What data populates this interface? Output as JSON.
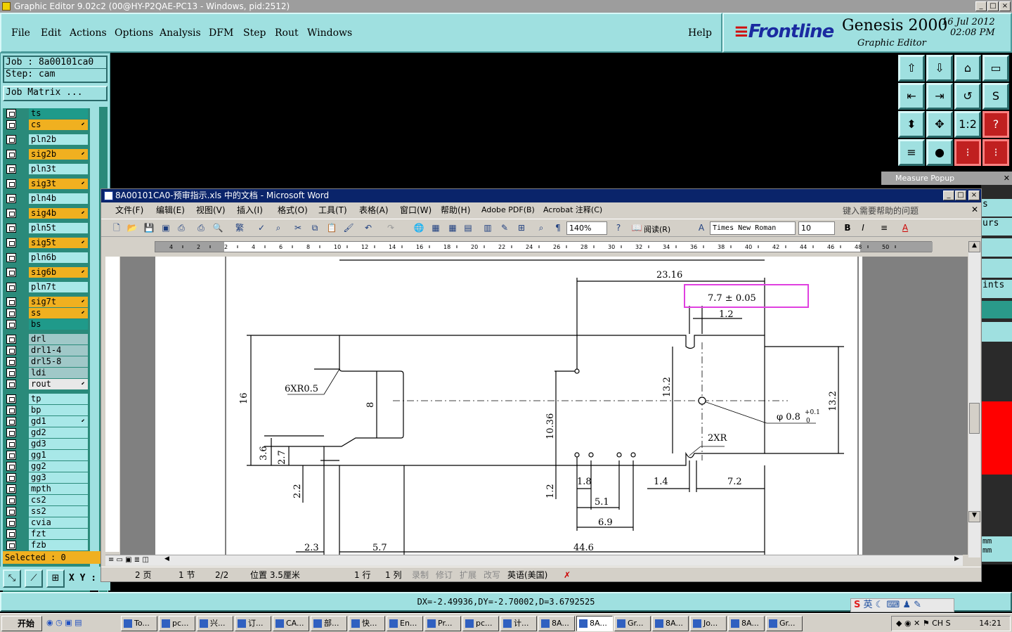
{
  "genesis": {
    "title": "Graphic Editor 9.02c2 (00@HY-P2QAE-PC13 - Windows, pid:2512)",
    "menu": [
      "File",
      "Edit",
      "Actions",
      "Options",
      "Analysis",
      "DFM",
      "Step",
      "Rout",
      "Windows"
    ],
    "help": "Help",
    "logo_brand": "Frontline",
    "logo_product": "Genesis 2000",
    "logo_sub": "Graphic Editor",
    "date": "16 Jul 2012",
    "time": "02:08 PM",
    "job": "Job : 8a00101ca0",
    "step": "Step: cam",
    "job_matrix": "Job Matrix ...",
    "layers": [
      {
        "name": "ts",
        "color": "#1f9a8a"
      },
      {
        "name": "cs",
        "color": "#f0b020",
        "arrow": true
      },
      {
        "name": "pln2b",
        "color": "#a8e8e8"
      },
      {
        "name": "sig2b",
        "color": "#f0b020",
        "arrow": true
      },
      {
        "name": "pln3t",
        "color": "#a8e8e8"
      },
      {
        "name": "sig3t",
        "color": "#f0b020",
        "arrow": true
      },
      {
        "name": "pln4b",
        "color": "#a8e8e8"
      },
      {
        "name": "sig4b",
        "color": "#f0b020",
        "arrow": true
      },
      {
        "name": "pln5t",
        "color": "#a8e8e8"
      },
      {
        "name": "sig5t",
        "color": "#f0b020",
        "arrow": true
      },
      {
        "name": "pln6b",
        "color": "#a8e8e8"
      },
      {
        "name": "sig6b",
        "color": "#f0b020",
        "arrow": true
      },
      {
        "name": "pln7t",
        "color": "#a8e8e8"
      },
      {
        "name": "sig7t",
        "color": "#f0b020",
        "arrow": true
      },
      {
        "name": "ss",
        "color": "#f0b020",
        "arrow": true
      },
      {
        "name": "bs",
        "color": "#1f9a8a"
      },
      {
        "name": "drl",
        "color": "#a0c8c8"
      },
      {
        "name": "drl1-4",
        "color": "#a0c8c8"
      },
      {
        "name": "drl5-8",
        "color": "#a0c8c8"
      },
      {
        "name": "ldi",
        "color": "#a0c8c8"
      },
      {
        "name": "rout",
        "color": "#e8e8e8",
        "arrow": true
      },
      {
        "name": "tp",
        "color": "#a8e8e8"
      },
      {
        "name": "bp",
        "color": "#a8e8e8"
      },
      {
        "name": "gd1",
        "color": "#a8e8e8",
        "arrow": true
      },
      {
        "name": "gd2",
        "color": "#a8e8e8"
      },
      {
        "name": "gd3",
        "color": "#a8e8e8"
      },
      {
        "name": "gg1",
        "color": "#a8e8e8"
      },
      {
        "name": "gg2",
        "color": "#a8e8e8"
      },
      {
        "name": "gg3",
        "color": "#a8e8e8"
      },
      {
        "name": "mpth",
        "color": "#a8e8e8"
      },
      {
        "name": "cs2",
        "color": "#a8e8e8"
      },
      {
        "name": "ss2",
        "color": "#a8e8e8"
      },
      {
        "name": "cvia",
        "color": "#a8e8e8"
      },
      {
        "name": "fzt",
        "color": "#a8e8e8"
      },
      {
        "name": "fzb",
        "color": "#a8e8e8"
      }
    ],
    "selected": "Selected : 0",
    "xy_label": "X Y :",
    "measure_popup": "Measure Popup",
    "coord_readout": "DX=-2.49936,DY=-2.70002,D=3.6792525"
  },
  "word": {
    "title": "8A00101CA0-预审指示.xls 中的文档 - Microsoft Word",
    "menu": [
      "文件(F)",
      "编辑(E)",
      "视图(V)",
      "插入(I)",
      "格式(O)",
      "工具(T)",
      "表格(A)",
      "窗口(W)",
      "帮助(H)",
      "Adobe PDF(B)",
      "Acrobat 注释(C)"
    ],
    "help_placeholder": "键入需要帮助的问题",
    "zoom": "140%",
    "read_btn": "阅读(R)",
    "font": "Times New Roman",
    "size": "10",
    "ruler_labels": [
      "4",
      "2",
      "2",
      "4",
      "6",
      "8",
      "10",
      "12",
      "14",
      "16",
      "18",
      "20",
      "22",
      "24",
      "26",
      "28",
      "30",
      "32",
      "34",
      "36",
      "38",
      "40",
      "42",
      "44",
      "46",
      "48",
      "50"
    ],
    "status": {
      "page": "2 页",
      "section": "1 节",
      "pages": "2/2",
      "position": "位置 3.5厘米",
      "line": "1 行",
      "col": "1 列",
      "rec": "录制",
      "trk": "修订",
      "ext": "扩展",
      "ovr": "改写",
      "lang": "英语(美国)"
    },
    "drawing": {
      "dims": [
        "23.16",
        "7.7 ± 0.05",
        "1.2",
        "6XR0.5",
        "16",
        "8",
        "13.2",
        "13.2",
        "10.36",
        "3.6",
        "2.7",
        "2.2",
        "1.2",
        "1.8",
        "5.1",
        "6.9",
        "1.4",
        "7.2",
        "2XR",
        "2.3",
        "5.7",
        "44.6"
      ],
      "phi": "φ 0.8",
      "phi_tol_upper": "+0.1",
      "phi_tol_lower": "0"
    }
  },
  "right_strip": [
    "s",
    "urs",
    "ints",
    "mm",
    "mm"
  ],
  "taskbar": {
    "start": "开始",
    "tasks": [
      "To...",
      "pc...",
      "兴...",
      "订...",
      "CA...",
      "部...",
      "快...",
      "En...",
      "Pr...",
      "pc...",
      "计...",
      "8A...",
      "8A...",
      "Gr...",
      "8A...",
      "Jo...",
      "8A...",
      "Gr..."
    ],
    "active_index": 12,
    "clock": "14:21",
    "ime": "英"
  }
}
